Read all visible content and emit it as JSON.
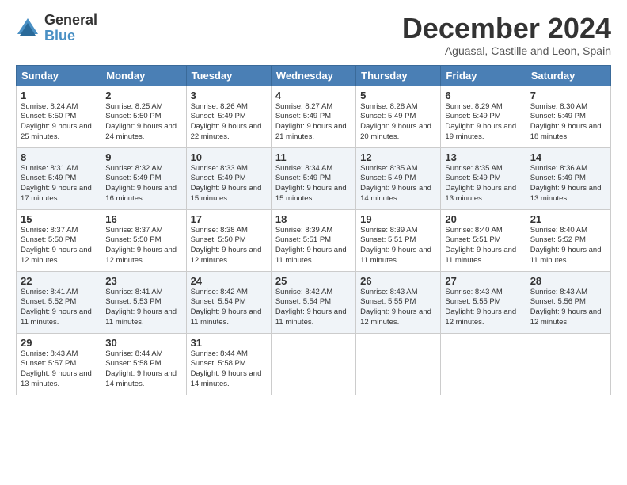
{
  "logo": {
    "general": "General",
    "blue": "Blue"
  },
  "title": "December 2024",
  "subtitle": "Aguasal, Castille and Leon, Spain",
  "days_header": [
    "Sunday",
    "Monday",
    "Tuesday",
    "Wednesday",
    "Thursday",
    "Friday",
    "Saturday"
  ],
  "weeks": [
    [
      {
        "day": "1",
        "sunrise": "8:24 AM",
        "sunset": "5:50 PM",
        "daylight": "9 hours and 25 minutes."
      },
      {
        "day": "2",
        "sunrise": "8:25 AM",
        "sunset": "5:50 PM",
        "daylight": "9 hours and 24 minutes."
      },
      {
        "day": "3",
        "sunrise": "8:26 AM",
        "sunset": "5:49 PM",
        "daylight": "9 hours and 22 minutes."
      },
      {
        "day": "4",
        "sunrise": "8:27 AM",
        "sunset": "5:49 PM",
        "daylight": "9 hours and 21 minutes."
      },
      {
        "day": "5",
        "sunrise": "8:28 AM",
        "sunset": "5:49 PM",
        "daylight": "9 hours and 20 minutes."
      },
      {
        "day": "6",
        "sunrise": "8:29 AM",
        "sunset": "5:49 PM",
        "daylight": "9 hours and 19 minutes."
      },
      {
        "day": "7",
        "sunrise": "8:30 AM",
        "sunset": "5:49 PM",
        "daylight": "9 hours and 18 minutes."
      }
    ],
    [
      {
        "day": "8",
        "sunrise": "8:31 AM",
        "sunset": "5:49 PM",
        "daylight": "9 hours and 17 minutes."
      },
      {
        "day": "9",
        "sunrise": "8:32 AM",
        "sunset": "5:49 PM",
        "daylight": "9 hours and 16 minutes."
      },
      {
        "day": "10",
        "sunrise": "8:33 AM",
        "sunset": "5:49 PM",
        "daylight": "9 hours and 15 minutes."
      },
      {
        "day": "11",
        "sunrise": "8:34 AM",
        "sunset": "5:49 PM",
        "daylight": "9 hours and 15 minutes."
      },
      {
        "day": "12",
        "sunrise": "8:35 AM",
        "sunset": "5:49 PM",
        "daylight": "9 hours and 14 minutes."
      },
      {
        "day": "13",
        "sunrise": "8:35 AM",
        "sunset": "5:49 PM",
        "daylight": "9 hours and 13 minutes."
      },
      {
        "day": "14",
        "sunrise": "8:36 AM",
        "sunset": "5:49 PM",
        "daylight": "9 hours and 13 minutes."
      }
    ],
    [
      {
        "day": "15",
        "sunrise": "8:37 AM",
        "sunset": "5:50 PM",
        "daylight": "9 hours and 12 minutes."
      },
      {
        "day": "16",
        "sunrise": "8:37 AM",
        "sunset": "5:50 PM",
        "daylight": "9 hours and 12 minutes."
      },
      {
        "day": "17",
        "sunrise": "8:38 AM",
        "sunset": "5:50 PM",
        "daylight": "9 hours and 12 minutes."
      },
      {
        "day": "18",
        "sunrise": "8:39 AM",
        "sunset": "5:51 PM",
        "daylight": "9 hours and 11 minutes."
      },
      {
        "day": "19",
        "sunrise": "8:39 AM",
        "sunset": "5:51 PM",
        "daylight": "9 hours and 11 minutes."
      },
      {
        "day": "20",
        "sunrise": "8:40 AM",
        "sunset": "5:51 PM",
        "daylight": "9 hours and 11 minutes."
      },
      {
        "day": "21",
        "sunrise": "8:40 AM",
        "sunset": "5:52 PM",
        "daylight": "9 hours and 11 minutes."
      }
    ],
    [
      {
        "day": "22",
        "sunrise": "8:41 AM",
        "sunset": "5:52 PM",
        "daylight": "9 hours and 11 minutes."
      },
      {
        "day": "23",
        "sunrise": "8:41 AM",
        "sunset": "5:53 PM",
        "daylight": "9 hours and 11 minutes."
      },
      {
        "day": "24",
        "sunrise": "8:42 AM",
        "sunset": "5:54 PM",
        "daylight": "9 hours and 11 minutes."
      },
      {
        "day": "25",
        "sunrise": "8:42 AM",
        "sunset": "5:54 PM",
        "daylight": "9 hours and 11 minutes."
      },
      {
        "day": "26",
        "sunrise": "8:43 AM",
        "sunset": "5:55 PM",
        "daylight": "9 hours and 12 minutes."
      },
      {
        "day": "27",
        "sunrise": "8:43 AM",
        "sunset": "5:55 PM",
        "daylight": "9 hours and 12 minutes."
      },
      {
        "day": "28",
        "sunrise": "8:43 AM",
        "sunset": "5:56 PM",
        "daylight": "9 hours and 12 minutes."
      }
    ],
    [
      {
        "day": "29",
        "sunrise": "8:43 AM",
        "sunset": "5:57 PM",
        "daylight": "9 hours and 13 minutes."
      },
      {
        "day": "30",
        "sunrise": "8:44 AM",
        "sunset": "5:58 PM",
        "daylight": "9 hours and 14 minutes."
      },
      {
        "day": "31",
        "sunrise": "8:44 AM",
        "sunset": "5:58 PM",
        "daylight": "9 hours and 14 minutes."
      },
      null,
      null,
      null,
      null
    ]
  ],
  "labels": {
    "sunrise_prefix": "Sunrise: ",
    "sunset_prefix": "Sunset: ",
    "daylight_prefix": "Daylight: "
  }
}
